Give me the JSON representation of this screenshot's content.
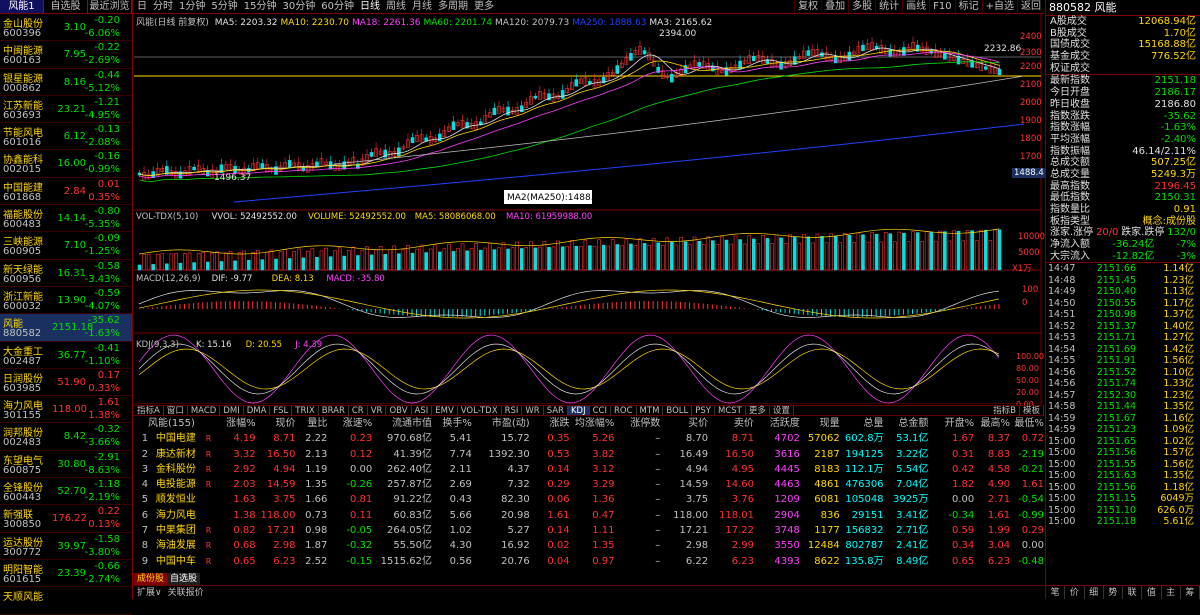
{
  "left": {
    "tabs": [
      "风能1",
      "自选股",
      "最近浏览"
    ],
    "items": [
      {
        "name": "金山股份",
        "code": "600396",
        "price": "3.10",
        "chg": "-0.20",
        "pct": "-6.06%",
        "dir": "dn"
      },
      {
        "name": "中闽能源",
        "code": "600163",
        "price": "7.95",
        "chg": "-0.22",
        "pct": "-2.69%",
        "dir": "dn"
      },
      {
        "name": "银星能源",
        "code": "000862",
        "price": "8.16",
        "chg": "-0.44",
        "pct": "-5.12%",
        "dir": "dn"
      },
      {
        "name": "江苏新能",
        "code": "603693",
        "price": "23.21",
        "chg": "-1.21",
        "pct": "-4.95%",
        "dir": "dn"
      },
      {
        "name": "节能风电",
        "code": "601016",
        "price": "6.12",
        "chg": "-0.13",
        "pct": "-2.08%",
        "dir": "dn"
      },
      {
        "name": "协鑫能科",
        "code": "002015",
        "price": "16.00",
        "chg": "-0.16",
        "pct": "-0.99%",
        "dir": "dn"
      },
      {
        "name": "中国能建",
        "code": "601868",
        "price": "2.84",
        "chg": "0.01",
        "pct": "0.35%",
        "dir": "up"
      },
      {
        "name": "福能股份",
        "code": "600483",
        "price": "14.14",
        "chg": "-0.80",
        "pct": "-5.35%",
        "dir": "dn"
      },
      {
        "name": "三峡能源",
        "code": "600905",
        "price": "7.10",
        "chg": "-0.09",
        "pct": "-1.25%",
        "dir": "dn"
      },
      {
        "name": "新天绿能",
        "code": "600956",
        "price": "16.31",
        "chg": "-0.58",
        "pct": "-3.43%",
        "dir": "dn"
      },
      {
        "name": "浙江新能",
        "code": "600032",
        "price": "13.90",
        "chg": "-0.59",
        "pct": "-4.07%",
        "dir": "dn"
      },
      {
        "name": "风能",
        "code": "880582",
        "price": "2151.18",
        "chg": "-35.62",
        "pct": "-1.63%",
        "dir": "dn",
        "sel": true
      },
      {
        "name": "大金重工",
        "code": "002487",
        "price": "36.77",
        "chg": "-0.41",
        "pct": "-1.10%",
        "dir": "dn"
      },
      {
        "name": "日润股份",
        "code": "603985",
        "price": "51.90",
        "chg": "0.17",
        "pct": "0.33%",
        "dir": "up"
      },
      {
        "name": "海力风电",
        "code": "301155",
        "price": "118.00",
        "chg": "1.61",
        "pct": "1.38%",
        "dir": "up"
      },
      {
        "name": "润邦股份",
        "code": "002483",
        "price": "8.42",
        "chg": "-0.32",
        "pct": "-3.66%",
        "dir": "dn"
      },
      {
        "name": "东望电气",
        "code": "600875",
        "price": "30.80",
        "chg": "-2.91",
        "pct": "-8.63%",
        "dir": "dn"
      },
      {
        "name": "全锋股份",
        "code": "600443",
        "price": "52.70",
        "chg": "-1.18",
        "pct": "-2.19%",
        "dir": "dn"
      },
      {
        "name": "新强联",
        "code": "300850",
        "price": "176.22",
        "chg": "0.22",
        "pct": "0.13%",
        "dir": "up"
      },
      {
        "name": "运达股份",
        "code": "300772",
        "price": "39.97",
        "chg": "-1.58",
        "pct": "-3.80%",
        "dir": "dn"
      },
      {
        "name": "明阳智能",
        "code": "601615",
        "price": "23.39",
        "chg": "-0.66",
        "pct": "-2.74%",
        "dir": "dn"
      },
      {
        "name": "天顺风能",
        "code": "",
        "price": "",
        "chg": "",
        "pct": "",
        "dir": "dn"
      }
    ]
  },
  "topbar": {
    "left": [
      "日",
      "分时",
      "1分钟",
      "5分钟",
      "15分钟",
      "30分钟",
      "60分钟",
      "日线",
      "周线",
      "月线",
      "多周期",
      "更多"
    ],
    "right": [
      "复权",
      "叠加",
      "多股",
      "统计",
      "画线",
      "F10",
      "标记",
      "+自选",
      "返回"
    ]
  },
  "main": {
    "title": "风能(日线 前复权)",
    "ma": [
      {
        "t": "MA5: 2203.32",
        "c": "#e0e0e0"
      },
      {
        "t": "MA10: 2230.70",
        "c": "#ffd700"
      },
      {
        "t": "MA18: 2261.36",
        "c": "#ff40ff"
      },
      {
        "t": "MA60: 2201.74",
        "c": "#00e000"
      },
      {
        "t": "MA120: 2079.73",
        "c": "#c0c0c0"
      },
      {
        "t": "MA250: 1888.63",
        "c": "#2040ff"
      },
      {
        "t": "MA3: 2165.62",
        "c": "#e0e0e0"
      }
    ],
    "hi_label": "2394.00",
    "lo_label": "1496.37",
    "last_label": "2232.86",
    "tooltip": "MA2(MA250):1488.22",
    "price_tag": "1488.4"
  },
  "axis": {
    "price": [
      "2400",
      "2300",
      "2200",
      "2100",
      "2000",
      "1900",
      "1800",
      "1700",
      "1600"
    ],
    "vol": [
      "10000",
      "5000"
    ],
    "vol_unit": "X1万",
    "macd": [
      "100",
      "0"
    ],
    "kdj": [
      "100.00",
      "80.00",
      "50.00",
      "20.00",
      "0.00"
    ]
  },
  "vol": {
    "legend": [
      {
        "t": "VOL-TDX(5,10)",
        "c": "#c0c0c0"
      },
      {
        "t": "VVOL: 52492552.00",
        "c": "#e0e0e0"
      },
      {
        "t": "VOLUME: 52492552.00",
        "c": "#ffd700"
      },
      {
        "t": "MA5: 58086068.00",
        "c": "#ffd700"
      },
      {
        "t": "MA10: 61959988.00",
        "c": "#ff40ff"
      }
    ]
  },
  "macd": {
    "legend": [
      {
        "t": "MACD(12,26,9)",
        "c": "#c0c0c0"
      },
      {
        "t": "DIF: -9.77",
        "c": "#e0e0e0"
      },
      {
        "t": "DEA: 8.13",
        "c": "#ffd700"
      },
      {
        "t": "MACD: -35.80",
        "c": "#ff40ff"
      }
    ]
  },
  "kdj": {
    "legend": [
      {
        "t": "KDJ(9,3,3)",
        "c": "#c0c0c0"
      },
      {
        "t": "K: 15.16",
        "c": "#e0e0e0"
      },
      {
        "t": "D: 20.55",
        "c": "#ffd700"
      },
      {
        "t": "J: 4.39",
        "c": "#ff40ff"
      }
    ]
  },
  "dates": [
    "2021年",
    "5",
    "6",
    "7",
    "8",
    "9",
    "10",
    "11",
    "12",
    "1"
  ],
  "date_sel": "2021/08/06/五",
  "rightbtn": "日线",
  "tabs2": [
    "指标A",
    "窗口",
    "MACD",
    "DMI",
    "DMA",
    "FSL",
    "TRIX",
    "BRAR",
    "CR",
    "VR",
    "OBV",
    "ASI",
    "EMV",
    "VOL-TDX",
    "RSI",
    "WR",
    "SAR",
    "KDJ",
    "CCI",
    "ROC",
    "MTM",
    "BOLL",
    "PSY",
    "MCST",
    "更多",
    "设置"
  ],
  "tabs2_right": [
    "指标B",
    "模板"
  ],
  "table": {
    "cols": [
      "风能(155)",
      "涨幅%",
      "现价",
      "量比",
      "涨速%",
      "流通市值",
      "换手%",
      "市盈(动)",
      "涨跌",
      "均涨幅%",
      "涨停数",
      "买价",
      "卖价",
      "活跃度",
      "现量",
      "总量",
      "总金额",
      "开盘%",
      "最高%",
      "最低%"
    ],
    "rows": [
      [
        "1",
        "中国电建",
        "R",
        "4.19",
        "8.71",
        "2.22",
        "0.23",
        "970.68亿",
        "5.41",
        "15.72",
        "0.35",
        "5.26",
        "–",
        "8.70",
        "8.71",
        "4702",
        "57062",
        "602.8万",
        "53.1亿",
        "1.67",
        "8.37",
        "0.72"
      ],
      [
        "2",
        "康达新材",
        "R",
        "3.32",
        "16.50",
        "2.13",
        "0.12",
        "41.39亿",
        "7.74",
        "1392.30",
        "0.53",
        "3.82",
        "–",
        "16.49",
        "16.50",
        "3616",
        "2187",
        "194125",
        "3.22亿",
        "0.31",
        "8.83",
        "-2.19"
      ],
      [
        "3",
        "金科股份",
        "R",
        "2.92",
        "4.94",
        "1.19",
        "0.00",
        "262.40亿",
        "2.11",
        "4.37",
        "0.14",
        "3.12",
        "–",
        "4.94",
        "4.95",
        "4445",
        "8183",
        "112.1万",
        "5.54亿",
        "0.42",
        "4.58",
        "-0.21"
      ],
      [
        "4",
        "电投能源",
        "R",
        "2.03",
        "14.59",
        "1.35",
        "-0.26",
        "257.87亿",
        "2.69",
        "7.32",
        "0.29",
        "3.29",
        "–",
        "14.59",
        "14.60",
        "4463",
        "4861",
        "476306",
        "7.04亿",
        "1.82",
        "4.90",
        "1.61"
      ],
      [
        "5",
        "顺发恒业",
        "",
        "1.63",
        "3.75",
        "1.66",
        "0.81",
        "91.22亿",
        "0.43",
        "82.30",
        "0.06",
        "1.36",
        "–",
        "3.75",
        "3.76",
        "1209",
        "6081",
        "105048",
        "3925万",
        "0.00",
        "2.71",
        "-0.54"
      ],
      [
        "6",
        "海力风电",
        "",
        "1.38",
        "118.00",
        "0.73",
        "0.11",
        "60.83亿",
        "5.66",
        "20.98",
        "1.61",
        "0.47",
        "–",
        "118.00",
        "118.01",
        "2904",
        "836",
        "29151",
        "3.41亿",
        "-0.34",
        "1.61",
        "-0.99"
      ],
      [
        "7",
        "中果集团",
        "R",
        "0.82",
        "17.21",
        "0.98",
        "-0.05",
        "264.05亿",
        "1.02",
        "5.27",
        "0.14",
        "1.11",
        "–",
        "17.21",
        "17.22",
        "3748",
        "1177",
        "156832",
        "2.71亿",
        "0.59",
        "1.99",
        "0.29"
      ],
      [
        "8",
        "海油发展",
        "R",
        "0.68",
        "2.98",
        "1.87",
        "-0.32",
        "55.50亿",
        "4.30",
        "16.92",
        "0.02",
        "1.35",
        "–",
        "2.98",
        "2.99",
        "3550",
        "12484",
        "802787",
        "2.41亿",
        "0.34",
        "3.04",
        "0.00"
      ],
      [
        "9",
        "中国中车",
        "R",
        "0.65",
        "6.23",
        "2.52",
        "-0.15",
        "1515.62亿",
        "0.56",
        "20.76",
        "0.04",
        "0.97",
        "–",
        "6.22",
        "6.23",
        "4393",
        "8622",
        "135.8万",
        "8.49亿",
        "0.65",
        "6.23",
        "-0.48"
      ]
    ]
  },
  "btm_tabs": [
    "成份股",
    "自选股"
  ],
  "btm2": [
    "扩展∨",
    "关联报价"
  ],
  "right": {
    "title": "880582 风能",
    "stats1": [
      [
        "A股成交",
        "12068.94亿"
      ],
      [
        "B股成交",
        "1.70亿"
      ],
      [
        "国债成交",
        "15168.88亿"
      ],
      [
        "基金成交",
        "776.52亿"
      ],
      [
        "权证成交",
        ""
      ]
    ],
    "stats2": [
      [
        "最新指数",
        "2151.18",
        "dn"
      ],
      [
        "今日开盘",
        "2186.17",
        "dn"
      ],
      [
        "昨日收盘",
        "2186.80",
        "wh"
      ],
      [
        "指数涨跌",
        "-35.62",
        "dn"
      ],
      [
        "指数涨幅",
        "-1.63%",
        "dn"
      ],
      [
        "平均涨幅",
        "-2.40%",
        "dn"
      ],
      [
        "指数振幅",
        "46.14/2.11%",
        "wh"
      ],
      [
        "总成交额",
        "507.25亿",
        "yl"
      ],
      [
        "总成交量",
        "5249.3万",
        "yl"
      ],
      [
        "最高指数",
        "2196.45",
        "up"
      ],
      [
        "最低指数",
        "2150.31",
        "dn"
      ],
      [
        "指数量比",
        "0.91",
        "yl"
      ],
      [
        "板指类型",
        "概念:成份股",
        "yl"
      ]
    ],
    "zd": [
      "涨家.涨停",
      "20/0",
      "跌家.跌停",
      "132/0"
    ],
    "flow": [
      [
        "净流入额",
        "-36.24亿",
        "-7%"
      ],
      [
        "大宗流入",
        "-12.82亿",
        "-3%"
      ]
    ],
    "ticks": [
      [
        "14:47",
        "2151.66",
        "1.14亿"
      ],
      [
        "14:48",
        "2151.45",
        "1.23亿"
      ],
      [
        "14:49",
        "2150.40",
        "1.13亿"
      ],
      [
        "14:50",
        "2150.55",
        "1.17亿"
      ],
      [
        "14:51",
        "2150.98",
        "1.37亿"
      ],
      [
        "14:52",
        "2151.37",
        "1.40亿"
      ],
      [
        "14:53",
        "2151.71",
        "1.27亿"
      ],
      [
        "14:54",
        "2151.69",
        "1.42亿"
      ],
      [
        "14:55",
        "2151.91",
        "1.56亿"
      ],
      [
        "14:56",
        "2151.52",
        "1.10亿"
      ],
      [
        "14:56",
        "2151.74",
        "1.33亿"
      ],
      [
        "14:57",
        "2152.30",
        "1.23亿"
      ],
      [
        "14:58",
        "2151.44",
        "1.35亿"
      ],
      [
        "14:59",
        "2151.67",
        "1.16亿"
      ],
      [
        "14:59",
        "2151.23",
        "1.09亿"
      ],
      [
        "15:00",
        "2151.65",
        "1.02亿"
      ],
      [
        "15:00",
        "2151.56",
        "1.57亿"
      ],
      [
        "15:00",
        "2151.55",
        "1.56亿"
      ],
      [
        "15:00",
        "2151.63",
        "1.35亿"
      ],
      [
        "15:00",
        "2151.56",
        "1.18亿"
      ],
      [
        "15:00",
        "2151.15",
        "6049万"
      ],
      [
        "15:00",
        "2151.10",
        "626.0万"
      ],
      [
        "15:00",
        "2151.18",
        "5.61亿"
      ]
    ],
    "foot": [
      "笔",
      "价",
      "细",
      "势",
      "联",
      "值",
      "主",
      "筹"
    ]
  }
}
